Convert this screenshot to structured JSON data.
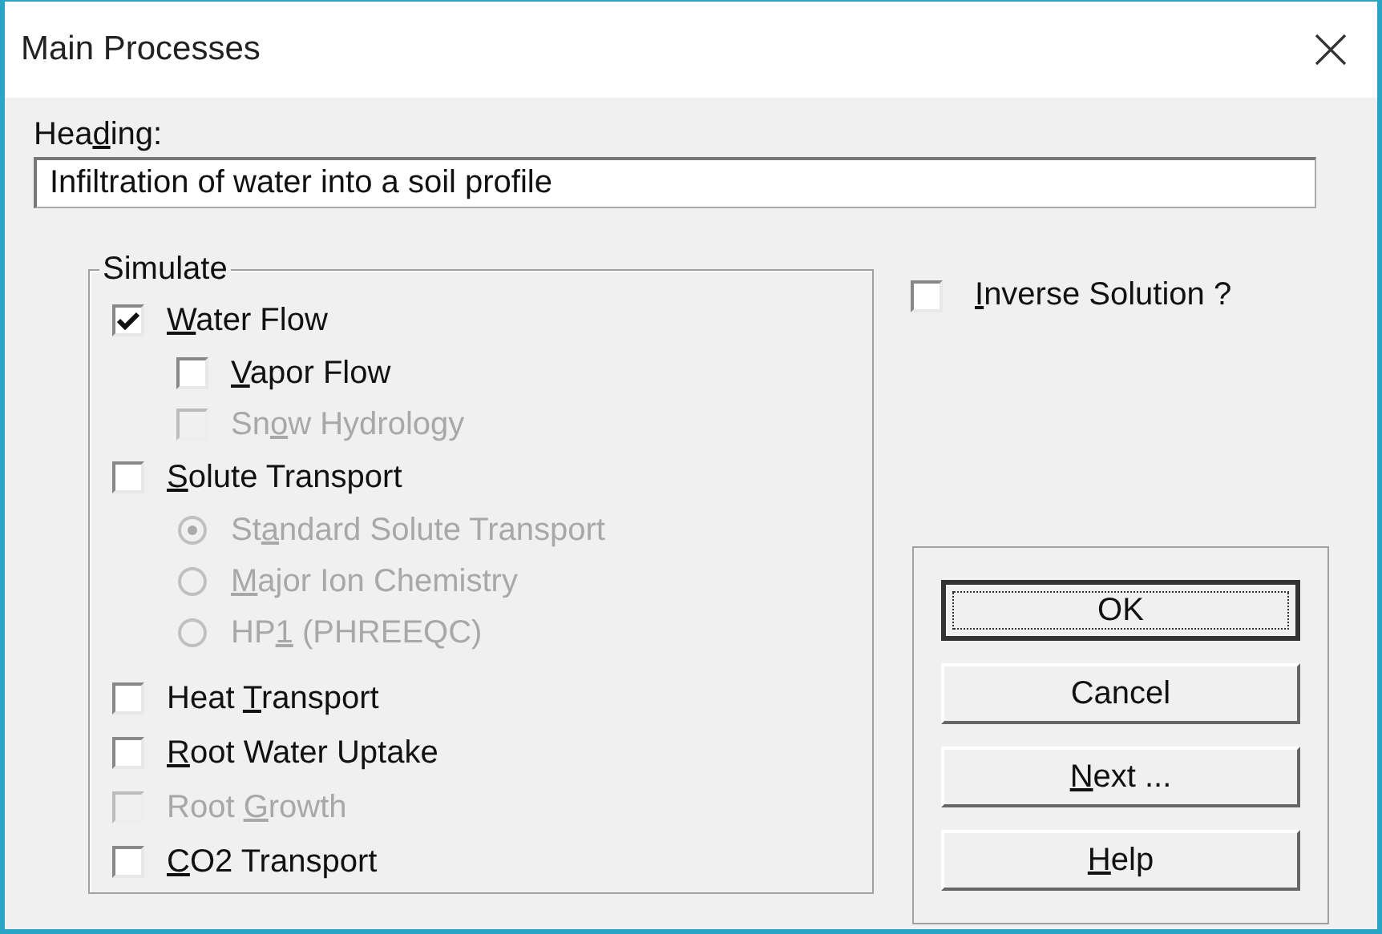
{
  "window": {
    "title": "Main Processes"
  },
  "heading": {
    "label": {
      "before": "Hea",
      "underlined": "d",
      "after": "ing:"
    },
    "value": "Infiltration of water into a soil profile"
  },
  "simulate": {
    "title": "Simulate",
    "items": [
      {
        "kind": "checkbox",
        "label": {
          "underlined": "W",
          "after": "ater Flow"
        },
        "checked": true,
        "disabled": false,
        "children": [
          {
            "kind": "checkbox",
            "label": {
              "underlined": "V",
              "after": "apor Flow"
            },
            "checked": false,
            "disabled": false
          },
          {
            "kind": "checkbox",
            "label": {
              "before": "Sn",
              "underlined": "o",
              "after": "w Hydrology"
            },
            "checked": false,
            "disabled": true
          }
        ]
      },
      {
        "kind": "checkbox",
        "label": {
          "underlined": "S",
          "after": "olute Transport"
        },
        "checked": false,
        "disabled": false,
        "children": [
          {
            "kind": "radio",
            "label": {
              "before": "St",
              "underlined": "a",
              "after": "ndard Solute Transport"
            },
            "selected": true,
            "disabled": true
          },
          {
            "kind": "radio",
            "label": {
              "underlined": "M",
              "after": "ajor Ion Chemistry"
            },
            "selected": false,
            "disabled": true
          },
          {
            "kind": "radio",
            "label": {
              "before": "HP",
              "underlined": "1",
              "after": " (PHREEQC)"
            },
            "selected": false,
            "disabled": true
          }
        ]
      },
      {
        "kind": "checkbox",
        "label": {
          "before": "Heat ",
          "underlined": "T",
          "after": "ransport"
        },
        "checked": false,
        "disabled": false
      },
      {
        "kind": "checkbox",
        "label": {
          "underlined": "R",
          "after": "oot Water Uptake"
        },
        "checked": false,
        "disabled": false
      },
      {
        "kind": "checkbox",
        "label": {
          "before": "Root ",
          "underlined": "G",
          "after": "rowth"
        },
        "checked": false,
        "disabled": true
      },
      {
        "kind": "checkbox",
        "label": {
          "underlined": "C",
          "after": "O2 Transport"
        },
        "checked": false,
        "disabled": false
      }
    ]
  },
  "inverse": {
    "label": {
      "underlined": "I",
      "after": "nverse Solution ?"
    },
    "checked": false
  },
  "buttons": [
    {
      "label": {
        "before": "OK"
      },
      "default": true
    },
    {
      "label": {
        "before": "Cancel"
      },
      "default": false
    },
    {
      "label": {
        "underlined": "N",
        "after": "ext ..."
      },
      "default": false
    },
    {
      "label": {
        "underlined": "H",
        "after": "elp"
      },
      "default": false
    }
  ]
}
